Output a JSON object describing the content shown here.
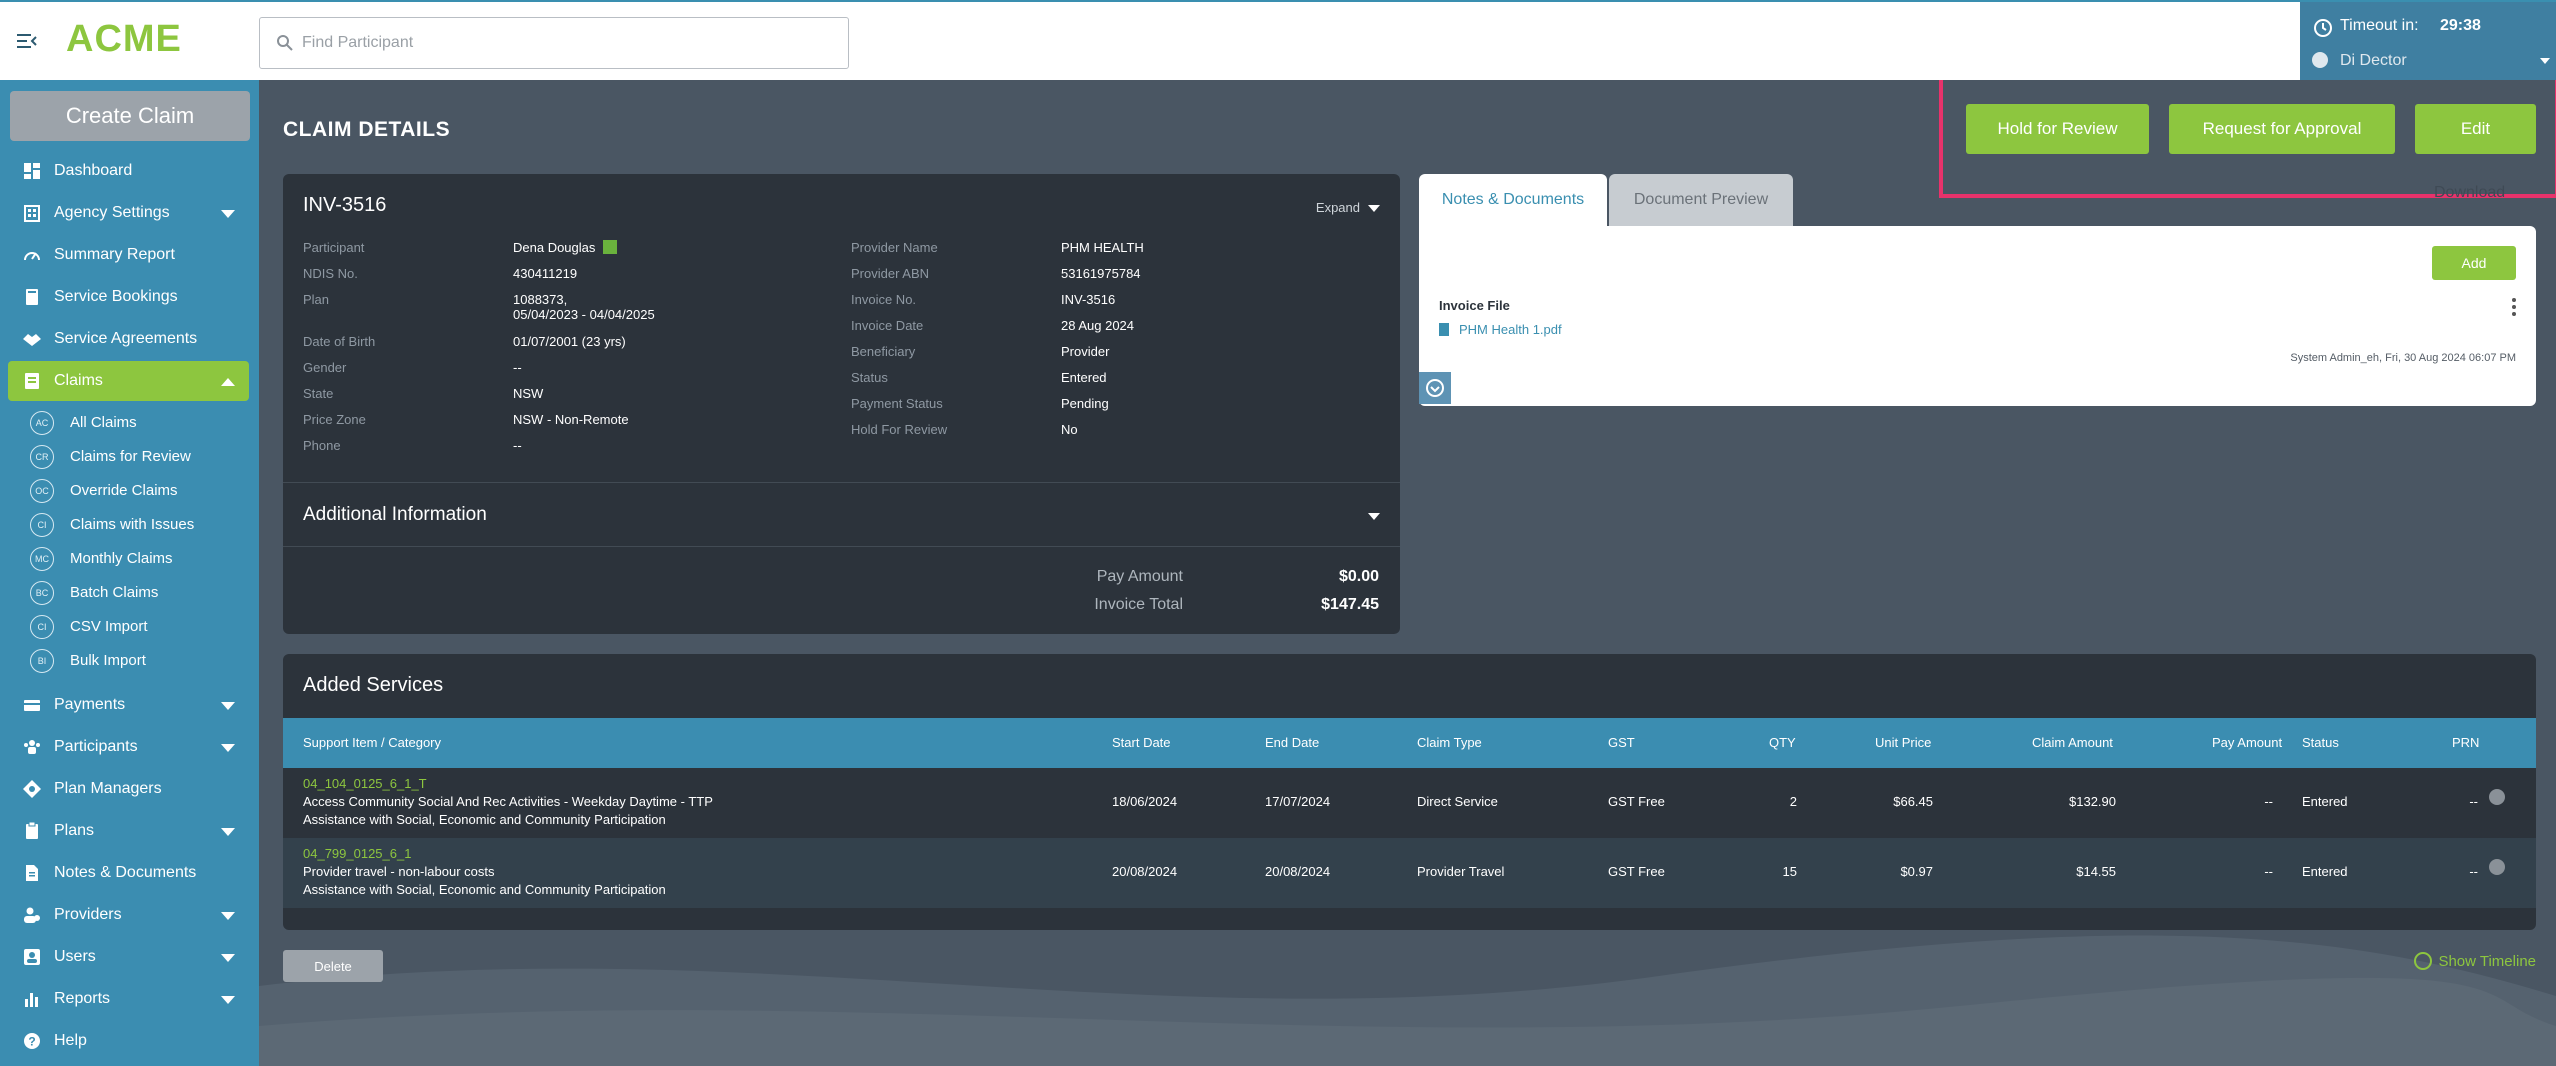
{
  "app": {
    "logo": "ACME"
  },
  "search": {
    "placeholder": "Find Participant"
  },
  "session": {
    "timeout_label": "Timeout in:",
    "timeout_value": "29:38",
    "user": "Di Dector"
  },
  "sidebar": {
    "create_label": "Create Claim",
    "items": [
      {
        "label": "Dashboard",
        "icon": "dashboard-icon"
      },
      {
        "label": "Agency Settings",
        "icon": "building-icon"
      },
      {
        "label": "Summary Report",
        "icon": "gauge-icon"
      },
      {
        "label": "Service Bookings",
        "icon": "book-icon"
      },
      {
        "label": "Service Agreements",
        "icon": "handshake-icon"
      },
      {
        "label": "Claims",
        "icon": "claims-icon"
      },
      {
        "label": "Payments",
        "icon": "payments-icon"
      },
      {
        "label": "Participants",
        "icon": "participants-icon"
      },
      {
        "label": "Plan Managers",
        "icon": "plan-manager-icon"
      },
      {
        "label": "Plans",
        "icon": "clipboard-icon"
      },
      {
        "label": "Notes & Documents",
        "icon": "document-icon"
      },
      {
        "label": "Providers",
        "icon": "providers-icon"
      },
      {
        "label": "Users",
        "icon": "user-icon"
      },
      {
        "label": "Reports",
        "icon": "bar-chart-icon"
      },
      {
        "label": "Help",
        "icon": "help-icon"
      }
    ],
    "claims_sub": [
      {
        "abbr": "AC",
        "label": "All Claims"
      },
      {
        "abbr": "CR",
        "label": "Claims for Review"
      },
      {
        "abbr": "OC",
        "label": "Override Claims"
      },
      {
        "abbr": "CI",
        "label": "Claims with Issues"
      },
      {
        "abbr": "MC",
        "label": "Monthly Claims"
      },
      {
        "abbr": "BC",
        "label": "Batch Claims"
      },
      {
        "abbr": "CI",
        "label": "CSV Import"
      },
      {
        "abbr": "BI",
        "label": "Bulk Import"
      }
    ]
  },
  "page": {
    "title": "CLAIM DETAILS"
  },
  "actions": {
    "hold": "Hold for Review",
    "request": "Request for Approval",
    "edit": "Edit"
  },
  "claim": {
    "invoice_id": "INV-3516",
    "expand_label": "Expand",
    "left": [
      {
        "k": "Participant",
        "v": "Dena Douglas"
      },
      {
        "k": "NDIS No.",
        "v": "430411219"
      },
      {
        "k": "Plan",
        "v": "1088373,",
        "v2": "05/04/2023 - 04/04/2025"
      },
      {
        "k": "Date of Birth",
        "v": "01/07/2001  (23 yrs)"
      },
      {
        "k": "Gender",
        "v": "--"
      },
      {
        "k": "State",
        "v": "NSW"
      },
      {
        "k": "Price Zone",
        "v": "NSW - Non-Remote"
      },
      {
        "k": "Phone",
        "v": "--"
      }
    ],
    "right": [
      {
        "k": "Provider Name",
        "v": "PHM HEALTH"
      },
      {
        "k": "Provider ABN",
        "v": "53161975784"
      },
      {
        "k": "Invoice No.",
        "v": "INV-3516"
      },
      {
        "k": "Invoice Date",
        "v": "28 Aug 2024"
      },
      {
        "k": "Beneficiary",
        "v": "Provider"
      },
      {
        "k": "Status",
        "v": "Entered"
      },
      {
        "k": "Payment Status",
        "v": "Pending"
      },
      {
        "k": "Hold For Review",
        "v": "No"
      }
    ],
    "additional_title": "Additional Information",
    "pay_amount_label": "Pay Amount",
    "pay_amount": "$0.00",
    "invoice_total_label": "Invoice Total",
    "invoice_total": "$147.45"
  },
  "notes": {
    "tab_notes": "Notes & Documents",
    "tab_preview": "Document Preview",
    "download": "Download",
    "add": "Add",
    "file_label": "Invoice File",
    "file_name": "PHM Health 1.pdf",
    "meta": "System Admin_eh, Fri, 30 Aug 2024 06:07 PM"
  },
  "services": {
    "title": "Added Services",
    "columns": [
      "Support Item / Category",
      "Start Date",
      "End Date",
      "Claim Type",
      "GST",
      "QTY",
      "Unit Price",
      "Claim Amount",
      "Pay Amount",
      "Status",
      "PRN"
    ],
    "rows": [
      {
        "code": "04_104_0125_6_1_T",
        "desc": "Access Community Social And Rec Activities - Weekday Daytime - TTP",
        "category": "Assistance with Social, Economic and Community Participation",
        "start": "18/06/2024",
        "end": "17/07/2024",
        "type": "Direct Service",
        "gst": "GST Free",
        "qty": "2",
        "unit": "$66.45",
        "claim": "$132.90",
        "pay": "--",
        "status": "Entered",
        "prn": "--"
      },
      {
        "code": "04_799_0125_6_1",
        "desc": "Provider travel - non-labour costs",
        "category": "Assistance with Social, Economic and Community Participation",
        "start": "20/08/2024",
        "end": "20/08/2024",
        "type": "Provider Travel",
        "gst": "GST Free",
        "qty": "15",
        "unit": "$0.97",
        "claim": "$14.55",
        "pay": "--",
        "status": "Entered",
        "prn": "--"
      }
    ],
    "delete": "Delete",
    "timeline": "Show Timeline"
  }
}
